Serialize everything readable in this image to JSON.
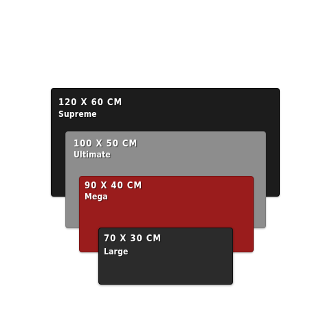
{
  "colors": {
    "background": "#ffffff",
    "supreme": "#1c1c1c",
    "ultimate": "#8d8d8d",
    "mega": "#9a1c1c",
    "large": "#2b2b2b",
    "text": "#ffffff"
  },
  "pads": {
    "supreme": {
      "size": "120 X 60 CM",
      "name": "Supreme"
    },
    "ultimate": {
      "size": "100 X 50 CM",
      "name": "Ultimate"
    },
    "mega": {
      "size": "90 X 40 CM",
      "name": "Mega"
    },
    "large": {
      "size": "70 X 30 CM",
      "name": "Large"
    }
  }
}
